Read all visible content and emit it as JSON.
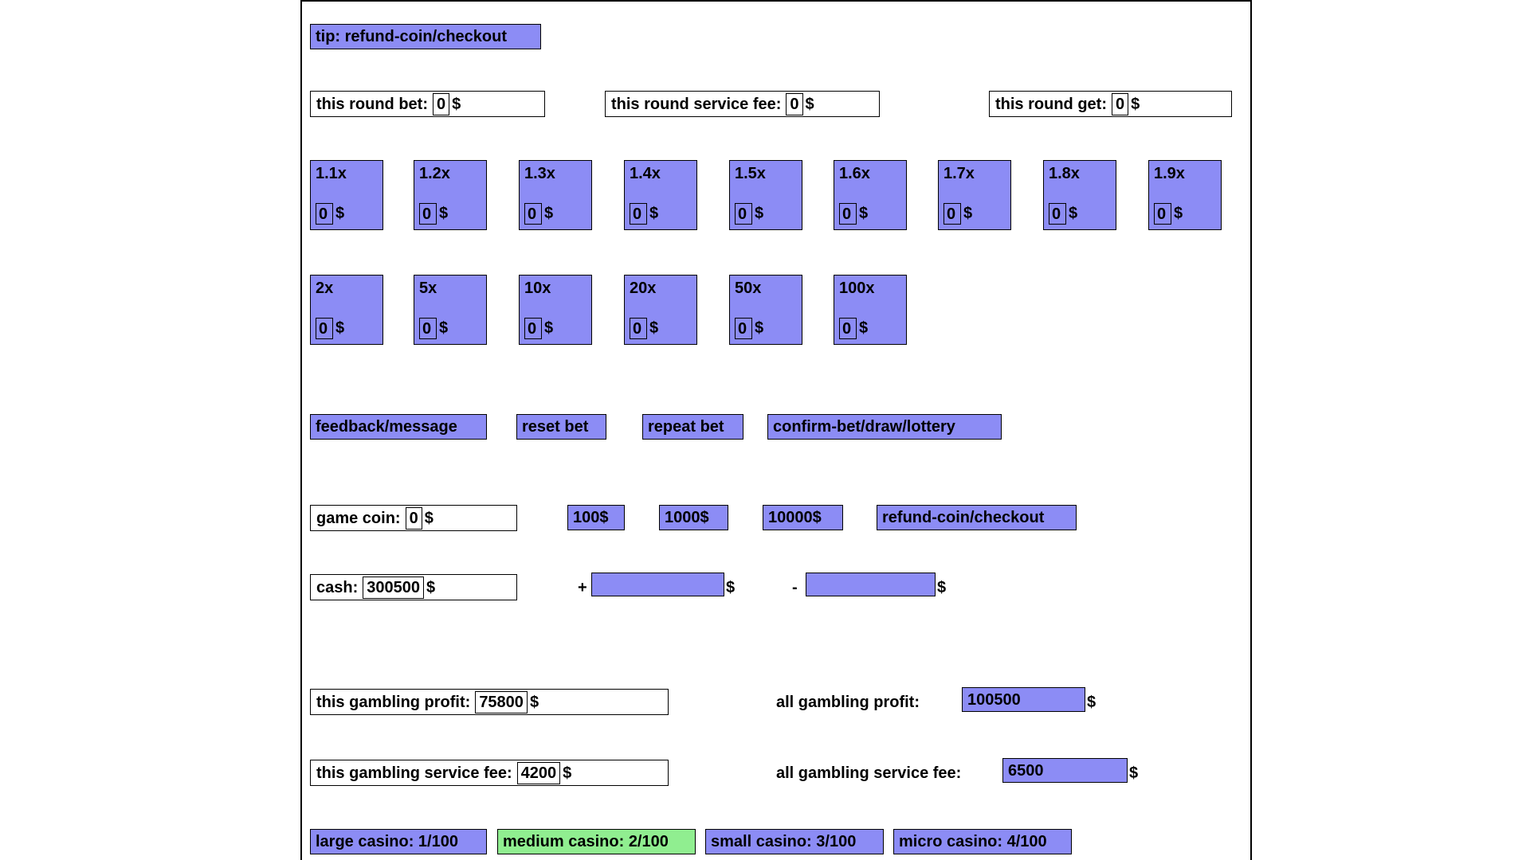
{
  "app": {
    "tip_button": "tip: refund-coin/checkout"
  },
  "round": {
    "bet": {
      "label": "this round bet:",
      "value": "0",
      "unit": "$"
    },
    "service_fee": {
      "label": "this round service fee:",
      "value": "0",
      "unit": "$"
    },
    "get": {
      "label": "this round get:",
      "value": "0",
      "unit": "$"
    }
  },
  "multipliers_row1": [
    {
      "name": "1.1x",
      "bet": "0",
      "unit": "$"
    },
    {
      "name": "1.2x",
      "bet": "0",
      "unit": "$"
    },
    {
      "name": "1.3x",
      "bet": "0",
      "unit": "$"
    },
    {
      "name": "1.4x",
      "bet": "0",
      "unit": "$"
    },
    {
      "name": "1.5x",
      "bet": "0",
      "unit": "$"
    },
    {
      "name": "1.6x",
      "bet": "0",
      "unit": "$"
    },
    {
      "name": "1.7x",
      "bet": "0",
      "unit": "$"
    },
    {
      "name": "1.8x",
      "bet": "0",
      "unit": "$"
    },
    {
      "name": "1.9x",
      "bet": "0",
      "unit": "$"
    }
  ],
  "multipliers_row2": [
    {
      "name": "2x",
      "bet": "0",
      "unit": "$"
    },
    {
      "name": "5x",
      "bet": "0",
      "unit": "$"
    },
    {
      "name": "10x",
      "bet": "0",
      "unit": "$"
    },
    {
      "name": "20x",
      "bet": "0",
      "unit": "$"
    },
    {
      "name": "50x",
      "bet": "0",
      "unit": "$"
    },
    {
      "name": "100x",
      "bet": "0",
      "unit": "$"
    }
  ],
  "actions": {
    "feedback": "feedback/message",
    "reset_bet": "reset bet",
    "repeat_bet": "repeat bet",
    "confirm": "confirm-bet/draw/lottery"
  },
  "coin": {
    "game_coin": {
      "label": "game coin:",
      "value": "0",
      "unit": "$"
    },
    "topup_100": "100$",
    "topup_1000": "1000$",
    "topup_10000": "10000$",
    "refund": "refund-coin/checkout"
  },
  "cash": {
    "label": "cash:",
    "value": "300500",
    "unit": "$",
    "plus_sign": "+",
    "plus_value": "",
    "plus_unit": "$",
    "minus_sign": "-",
    "minus_value": "",
    "minus_unit": "$"
  },
  "stats": {
    "this_profit": {
      "label": "this gambling profit:",
      "value": "75800",
      "unit": "$"
    },
    "all_profit": {
      "label": "all gambling profit:",
      "value": "100500",
      "unit": "$"
    },
    "this_fee": {
      "label": "this gambling service fee:",
      "value": "4200",
      "unit": "$"
    },
    "all_fee": {
      "label": "all gambling service fee:",
      "value": "6500",
      "unit": "$"
    }
  },
  "casinos": [
    {
      "label": "large casino: 1/100",
      "selected": false
    },
    {
      "label": "medium casino: 2/100",
      "selected": true
    },
    {
      "label": "small casino: 3/100",
      "selected": false
    },
    {
      "label": "micro casino: 4/100",
      "selected": false
    }
  ],
  "colors": {
    "accent": "#8c8cf5",
    "selected": "#90ee90",
    "border": "#000000",
    "background": "#ffffff"
  }
}
